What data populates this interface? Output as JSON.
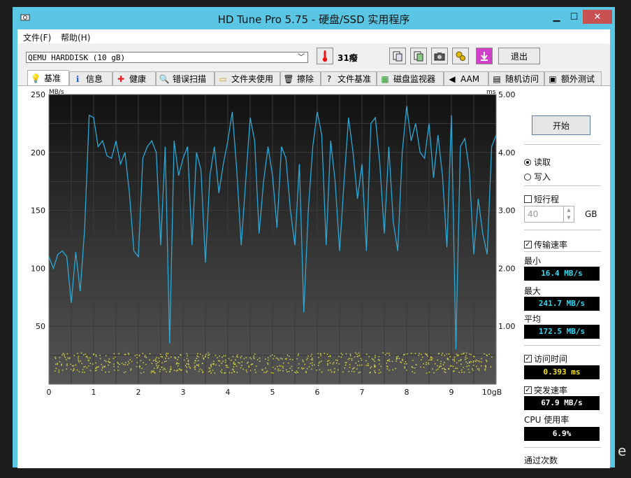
{
  "window": {
    "title": "HD Tune Pro 5.75 - 硬盘/SSD 实用程序"
  },
  "menu": {
    "file": "文件(F)",
    "help": "帮助(H)"
  },
  "toolbar": {
    "drive": "QEMU HARDDISK (10 gB)",
    "temperature": "31癈",
    "exit_label": "退出"
  },
  "tabs": [
    {
      "label": "基准",
      "icon": "benchmark-icon"
    },
    {
      "label": "信息",
      "icon": "info-icon"
    },
    {
      "label": "健康",
      "icon": "health-icon"
    },
    {
      "label": "错误扫描",
      "icon": "error-scan-icon"
    },
    {
      "label": "文件夹使用",
      "icon": "folder-icon"
    },
    {
      "label": "擦除",
      "icon": "erase-icon"
    },
    {
      "label": "文件基准",
      "icon": "file-benchmark-icon"
    },
    {
      "label": "磁盘监视器",
      "icon": "disk-monitor-icon"
    },
    {
      "label": "AAM",
      "icon": "speaker-icon"
    },
    {
      "label": "随机访问",
      "icon": "random-access-icon"
    },
    {
      "label": "额外测试",
      "icon": "extra-tests-icon"
    }
  ],
  "side": {
    "start_label": "开始",
    "read_label": "读取",
    "write_label": "写入",
    "short_stroke_label": "短行程",
    "short_stroke_value": "40",
    "short_stroke_unit": "GB",
    "transfer_rate_label": "传输速率",
    "min_label": "最小",
    "min_value": "16.4 MB/s",
    "max_label": "最大",
    "max_value": "241.7 MB/s",
    "avg_label": "平均",
    "avg_value": "172.5 MB/s",
    "access_time_label": "访问时间",
    "access_time_value": "0.393 ms",
    "burst_rate_label": "突发速率",
    "burst_rate_value": "67.9 MB/s",
    "cpu_label": "CPU 使用率",
    "cpu_value": "6.9%",
    "passes_label": "通过次数"
  },
  "chart_data": {
    "type": "line",
    "y_left_label": "MB/s",
    "y_right_label": "ms",
    "xlim": [
      0,
      10
    ],
    "ylim_left": [
      0,
      250
    ],
    "ylim_right": [
      0,
      5
    ],
    "x_ticks": [
      "0",
      "1",
      "2",
      "3",
      "4",
      "5",
      "6",
      "7",
      "8",
      "9",
      "10gB"
    ],
    "y_left_ticks": [
      "50",
      "100",
      "150",
      "200",
      "250"
    ],
    "y_right_ticks": [
      "1.00",
      "2.00",
      "3.00",
      "4.00",
      "5.00"
    ],
    "grid": true,
    "series": [
      {
        "color": "#2aa8d6",
        "x": [
          0,
          0.1,
          0.2,
          0.3,
          0.4,
          0.5,
          0.6,
          0.7,
          0.8,
          0.9,
          1.0,
          1.1,
          1.2,
          1.3,
          1.4,
          1.5,
          1.6,
          1.7,
          1.8,
          1.9,
          2.0,
          2.1,
          2.2,
          2.3,
          2.4,
          2.5,
          2.6,
          2.7,
          2.8,
          2.9,
          3.0,
          3.1,
          3.2,
          3.3,
          3.4,
          3.5,
          3.6,
          3.7,
          3.8,
          3.9,
          4.0,
          4.1,
          4.2,
          4.3,
          4.4,
          4.5,
          4.6,
          4.7,
          4.8,
          4.9,
          5.0,
          5.1,
          5.2,
          5.3,
          5.4,
          5.5,
          5.6,
          5.7,
          5.8,
          5.9,
          6.0,
          6.1,
          6.2,
          6.3,
          6.4,
          6.5,
          6.6,
          6.7,
          6.8,
          6.9,
          7.0,
          7.1,
          7.2,
          7.3,
          7.4,
          7.5,
          7.6,
          7.7,
          7.8,
          7.9,
          8.0,
          8.1,
          8.2,
          8.3,
          8.4,
          8.5,
          8.6,
          8.7,
          8.8,
          8.9,
          9.0,
          9.1,
          9.2,
          9.3,
          9.4,
          9.5,
          9.6,
          9.7,
          9.8,
          9.9,
          10.0
        ],
        "values": [
          110,
          100,
          112,
          115,
          110,
          70,
          114,
          80,
          135,
          232,
          230,
          205,
          210,
          197,
          195,
          210,
          190,
          200,
          165,
          115,
          110,
          195,
          205,
          210,
          200,
          120,
          205,
          35,
          210,
          180,
          195,
          205,
          120,
          200,
          185,
          105,
          180,
          205,
          165,
          190,
          210,
          235,
          185,
          120,
          175,
          230,
          210,
          130,
          175,
          205,
          180,
          135,
          205,
          195,
          150,
          120,
          190,
          62,
          150,
          205,
          235,
          215,
          120,
          210,
          175,
          115,
          175,
          230,
          200,
          160,
          190,
          115,
          225,
          230,
          190,
          130,
          205,
          140,
          115,
          200,
          240,
          210,
          225,
          200,
          195,
          225,
          178,
          215,
          180,
          118,
          232,
          30,
          205,
          212,
          185,
          112,
          160,
          130,
          112,
          205,
          215
        ]
      }
    ],
    "scatter": {
      "color": "#d8d840",
      "x_range": [
        0.1,
        9.9
      ],
      "y_range_ms": [
        0.2,
        0.55
      ],
      "note_count": 720
    }
  }
}
